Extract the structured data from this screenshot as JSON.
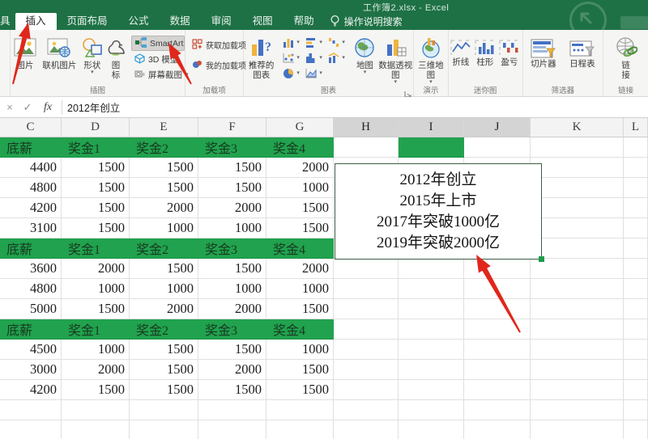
{
  "window": {
    "title": "工作簿2.xlsx - Excel"
  },
  "tabs": {
    "partial_left": "具",
    "active": "插入",
    "items": [
      "插入",
      "页面布局",
      "公式",
      "数据",
      "审阅",
      "视图",
      "帮助"
    ],
    "search_label": "操作说明搜索"
  },
  "ribbon": {
    "illustrations": {
      "label": "插图",
      "pictures": "图片",
      "online_pictures": "联机图片",
      "shapes": "形状",
      "icons": "图标",
      "smartart": "SmartArt",
      "model_3d": "3D 模型",
      "screenshot": "屏幕截图"
    },
    "addins": {
      "label": "加载项",
      "get_addins": "获取加载项",
      "my_addins": "我的加载项"
    },
    "charts": {
      "label": "图表",
      "recommended_line1": "推荐的",
      "recommended_line2": "图表",
      "map": "地图",
      "pivot_chart": "数据透视图"
    },
    "tours": {
      "label": "演示",
      "map_3d": "三维地图"
    },
    "sparklines": {
      "label": "迷你图",
      "line": "折线",
      "column": "柱形",
      "win_loss": "盈亏"
    },
    "filters": {
      "label": "筛选器",
      "slicer": "切片器",
      "timeline": "日程表"
    },
    "links": {
      "label": "链接",
      "link_line1": "链",
      "link_line2": "接"
    }
  },
  "formula_bar": {
    "cancel": "×",
    "check": "✓",
    "fx": "fx",
    "value": "2012年创立"
  },
  "sheet": {
    "columns": [
      {
        "letter": "C",
        "selected": false
      },
      {
        "letter": "D",
        "selected": false
      },
      {
        "letter": "E",
        "selected": false
      },
      {
        "letter": "F",
        "selected": false
      },
      {
        "letter": "G",
        "selected": false
      },
      {
        "letter": "H",
        "selected": true
      },
      {
        "letter": "I",
        "selected": true
      },
      {
        "letter": "J",
        "selected": true
      },
      {
        "letter": "K",
        "selected": false
      },
      {
        "letter": "L",
        "selected": false
      }
    ],
    "rows": [
      {
        "kind": "band",
        "cells": [
          "底薪",
          "奖金1",
          "奖金2",
          "奖金3",
          "奖金4"
        ],
        "green_extra_col_index": 6
      },
      {
        "kind": "values",
        "cells": [
          "4400",
          "1500",
          "1500",
          "1500",
          "2000"
        ]
      },
      {
        "kind": "values",
        "cells": [
          "4800",
          "1500",
          "1500",
          "1500",
          "1000"
        ]
      },
      {
        "kind": "values",
        "cells": [
          "4200",
          "1500",
          "2000",
          "2000",
          "1500"
        ]
      },
      {
        "kind": "values",
        "cells": [
          "3100",
          "1500",
          "1000",
          "1000",
          "1500"
        ]
      },
      {
        "kind": "band",
        "cells": [
          "底薪",
          "奖金1",
          "奖金2",
          "奖金3",
          "奖金4"
        ]
      },
      {
        "kind": "values",
        "cells": [
          "3600",
          "2000",
          "1500",
          "1500",
          "2000"
        ]
      },
      {
        "kind": "values",
        "cells": [
          "4800",
          "1000",
          "1000",
          "1000",
          "1000"
        ]
      },
      {
        "kind": "values",
        "cells": [
          "5000",
          "1500",
          "2000",
          "2000",
          "1500"
        ]
      },
      {
        "kind": "band",
        "cells": [
          "底薪",
          "奖金1",
          "奖金2",
          "奖金3",
          "奖金4"
        ]
      },
      {
        "kind": "values",
        "cells": [
          "4500",
          "1000",
          "1500",
          "1500",
          "1000"
        ]
      },
      {
        "kind": "values",
        "cells": [
          "3000",
          "2000",
          "1500",
          "2000",
          "1500"
        ]
      },
      {
        "kind": "values",
        "cells": [
          "4200",
          "1500",
          "1500",
          "1500",
          "1500"
        ]
      },
      {
        "kind": "empty"
      },
      {
        "kind": "empty"
      }
    ]
  },
  "textbox": {
    "lines": [
      "2012年创立",
      "2015年上市",
      "2017年突破1000亿",
      "2019年突破2000亿"
    ]
  },
  "colors": {
    "title_green": "#1e7145",
    "band_green": "#21a24e",
    "arrow_red": "#e0271b"
  }
}
